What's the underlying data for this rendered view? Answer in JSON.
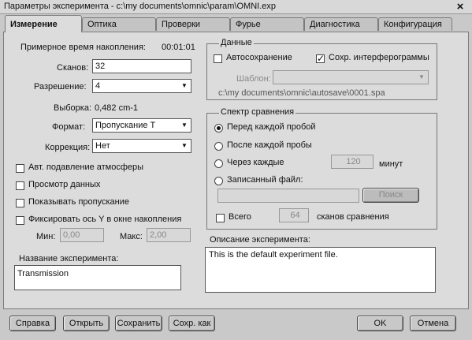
{
  "window": {
    "title": "Параметры эксперимента - c:\\my documents\\omnic\\param\\OMNI.exp",
    "close": "×"
  },
  "tabs": [
    "Измерение",
    "Оптика",
    "Проверки",
    "Фурье",
    "Диагностика",
    "Конфигурация"
  ],
  "left": {
    "collect_time_label": "Примерное время накопления:",
    "collect_time_value": "00:01:01",
    "scans_label": "Сканов:",
    "scans_value": "32",
    "resolution_label": "Разрешение:",
    "resolution_value": "4",
    "spacing_label": "Выборка:",
    "spacing_value": "0,482 cm-1",
    "format_label": "Формат:",
    "format_value": "Пропускание Т",
    "correction_label": "Коррекция:",
    "correction_value": "Нет",
    "checkboxes": [
      {
        "label": "Авт. подавление атмосферы"
      },
      {
        "label": "Просмотр данных"
      },
      {
        "label": "Показывать пропускание"
      },
      {
        "label": "Фиксировать ось Y в окне накопления"
      }
    ],
    "min_label": "Мин:",
    "min_value": "0,00",
    "max_label": "Макс:",
    "max_value": "2,00",
    "exp_name_label": "Название эксперимента:",
    "exp_name_value": "Transmission"
  },
  "data_group": {
    "title": "Данные",
    "autosave_label": "Автосохранение",
    "save_interf_label": "Сохр. интерферограммы",
    "template_label": "Шаблон:",
    "path": "c:\\my documents\\omnic\\autosave\\0001.spa"
  },
  "compare_group": {
    "title": "Спектр сравнения",
    "radios": [
      {
        "label": "Перед каждой пробой"
      },
      {
        "label": "После каждой пробы"
      },
      {
        "label": "Через каждые"
      },
      {
        "label": "Записанный файл:"
      }
    ],
    "interval_value": "120",
    "minutes_label": "минут",
    "browse_label": "Поиск",
    "total_label": "Всего",
    "total_value": "64",
    "total_suffix": "сканов сравнения"
  },
  "description": {
    "label": "Описание эксперимента:",
    "value": "This is the default experiment file."
  },
  "buttons": {
    "help": "Справка",
    "open": "Открыть",
    "save": "Сохранить",
    "save_as": "Сохр. как",
    "ok": "OK",
    "cancel": "Отмена"
  },
  "state": {
    "save_interferograms": true,
    "reference_mode": "Перед каждой пробой"
  }
}
